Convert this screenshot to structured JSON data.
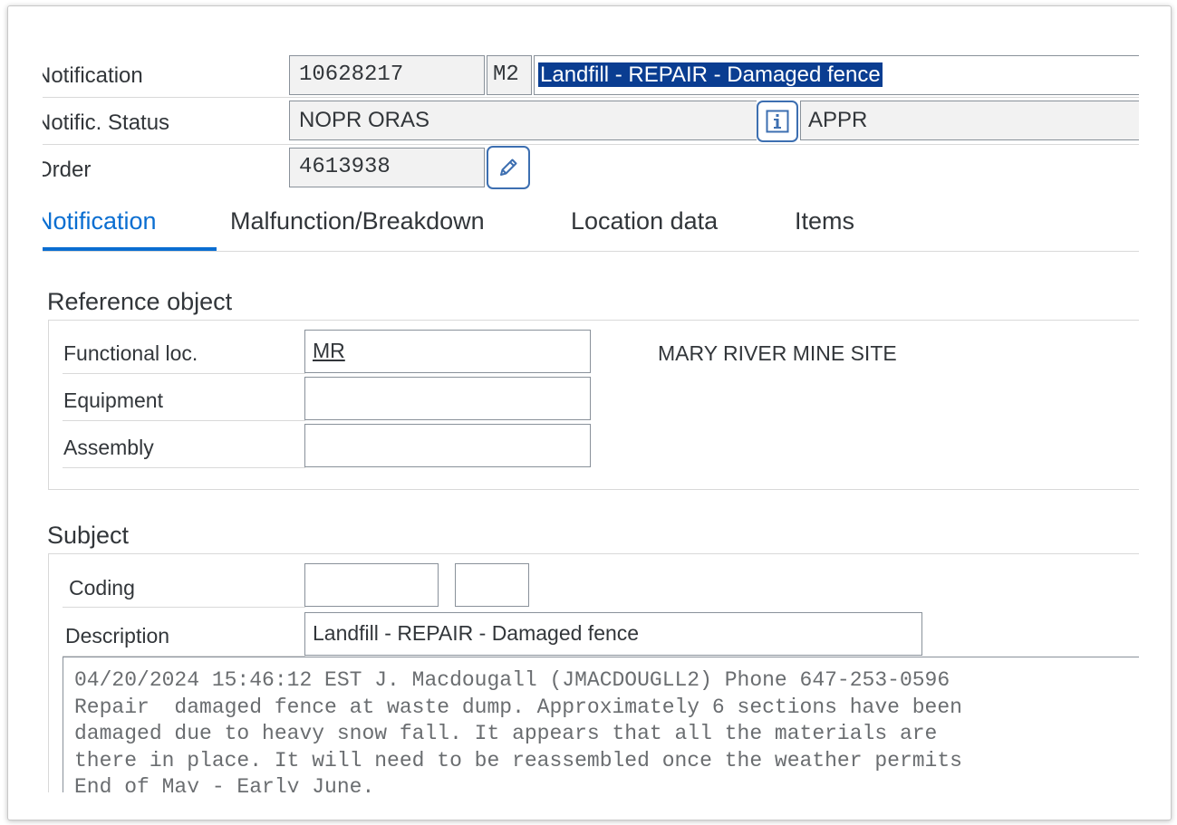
{
  "header": {
    "notification_label": "Notification",
    "notification_number": "10628217",
    "notification_type": "M2",
    "notification_short_text": "Landfill - REPAIR - Damaged fence",
    "status_label": "Notific. Status",
    "system_status": "NOPR ORAS",
    "user_status": "APPR",
    "order_label": "Order",
    "order_number": "4613938"
  },
  "tabs": [
    {
      "label": "Notification",
      "active": true
    },
    {
      "label": "Malfunction/Breakdown"
    },
    {
      "label": "Location data"
    },
    {
      "label": "Items"
    }
  ],
  "reference_object": {
    "title": "Reference object",
    "functional_loc_label": "Functional loc.",
    "functional_loc_value": "MR",
    "functional_loc_description": "MARY RIVER MINE SITE",
    "equipment_label": "Equipment",
    "equipment_value": "",
    "assembly_label": "Assembly",
    "assembly_value": ""
  },
  "subject": {
    "title": "Subject",
    "coding_label": "Coding",
    "coding_group": "",
    "coding_code": "",
    "description_label": "Description",
    "description_value": "Landfill - REPAIR - Damaged fence",
    "long_text": "04/20/2024 15:46:12 EST J. Macdougall (JMACDOUGLL2) Phone 647-253-0596\nRepair  damaged fence at waste dump. Approximately 6 sections have been\ndamaged due to heavy snow fall. It appears that all the materials are\nthere in place. It will need to be reassembled once the weather permits\nEnd of May - Early June."
  },
  "icons": {
    "info": "info-icon",
    "edit": "pencil-icon"
  },
  "colors": {
    "accent": "#0a6ed1",
    "selection": "#0a3d91",
    "icon_border": "#3d6fb1"
  }
}
